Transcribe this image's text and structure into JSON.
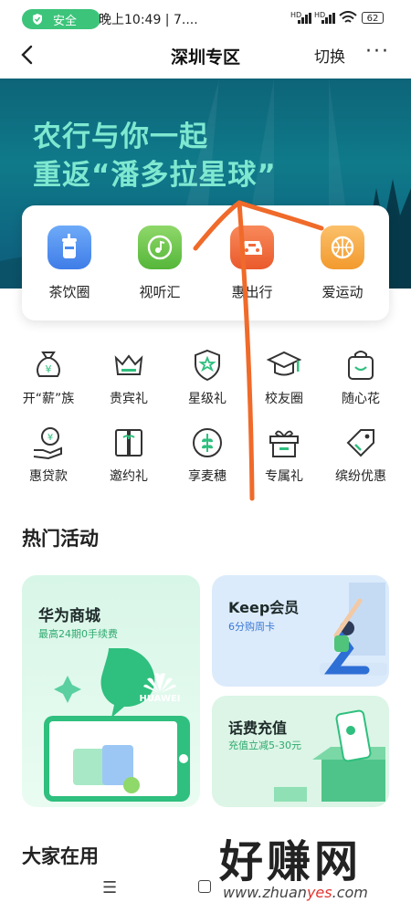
{
  "status_bar": {
    "safe_label": "安全",
    "time": "晚上10:49 | 7....",
    "signal1": "HD",
    "signal2": "HD",
    "battery": "62"
  },
  "nav": {
    "title": "深圳专区",
    "switch_label": "切换",
    "more": "···"
  },
  "banner": {
    "line1": "农行与你一起",
    "line2": "重返“潘多拉星球”"
  },
  "categories": [
    {
      "label": "茶饮圈",
      "icon": "drink-icon",
      "color": "#4a8cf0"
    },
    {
      "label": "视听汇",
      "icon": "music-icon",
      "color": "#6cc34a"
    },
    {
      "label": "惠出行",
      "icon": "car-icon",
      "color": "#f06a3a"
    },
    {
      "label": "爱运动",
      "icon": "ball-icon",
      "color": "#f5a43a"
    }
  ],
  "grid": [
    {
      "label": "开“薪”族",
      "icon": "money-bag-icon"
    },
    {
      "label": "贵宾礼",
      "icon": "crown-icon"
    },
    {
      "label": "星级礼",
      "icon": "star-shield-icon"
    },
    {
      "label": "校友圈",
      "icon": "graduation-cap-icon"
    },
    {
      "label": "随心花",
      "icon": "shopping-bag-icon"
    },
    {
      "label": "惠贷款",
      "icon": "loan-hand-icon"
    },
    {
      "label": "邀约礼",
      "icon": "gift-box-icon"
    },
    {
      "label": "享麦穗",
      "icon": "wheat-icon"
    },
    {
      "label": "专属礼",
      "icon": "gift-icon"
    },
    {
      "label": "缤纷优惠",
      "icon": "tag-icon"
    }
  ],
  "hot": {
    "title": "热门活动",
    "huawei": {
      "title": "华为商城",
      "subtitle": "最高24期0手续费",
      "logo_text": "HUAWEI"
    },
    "keep": {
      "title": "Keep会员",
      "subtitle": "6分购周卡"
    },
    "phone": {
      "title": "话费充值",
      "subtitle": "充值立减5-30元"
    }
  },
  "everyone_title": "大家在用",
  "bottom_nav": {
    "menu": "☰"
  },
  "watermark": {
    "text": "好赚网",
    "url_a": "www.zhuan",
    "url_b": "yes",
    "url_c": ".com"
  },
  "colors": {
    "accent": "#36c98a",
    "nav_bg": "#ffffff",
    "grid_icon": "#333333",
    "grid_accent": "#2fbf7e"
  }
}
